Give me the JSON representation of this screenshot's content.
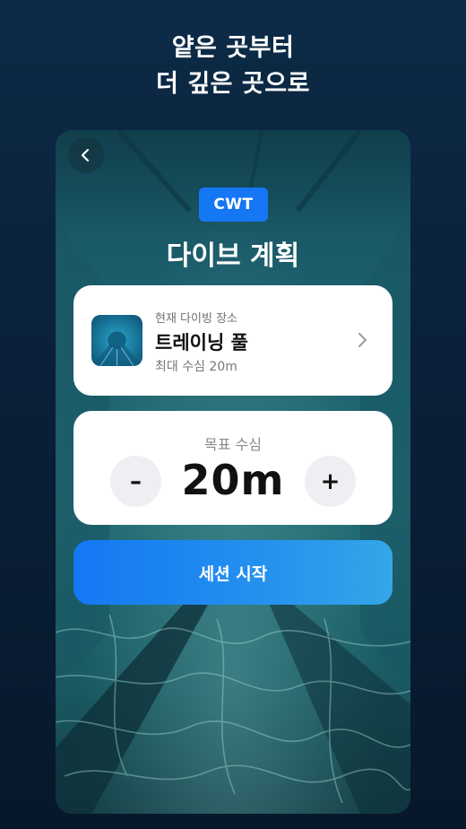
{
  "promo": {
    "line1": "얕은 곳부터",
    "line2": "더 깊은 곳으로"
  },
  "screen": {
    "mode_badge": "CWT",
    "title": "다이브 계획"
  },
  "location_card": {
    "caption": "현재 다이빙 장소",
    "name": "트레이닝 풀",
    "max_depth": "최대 수심 20m"
  },
  "depth_card": {
    "label": "목표 수심",
    "value": "20m",
    "minus_label": "–",
    "plus_label": "+"
  },
  "start_button": {
    "label": "세션 시작"
  },
  "colors": {
    "accent": "#1677f5",
    "card_bg": "#ffffff",
    "page_bg": "#0a2038"
  },
  "icons": {
    "back": "chevron-left-icon",
    "forward": "chevron-right-icon"
  }
}
